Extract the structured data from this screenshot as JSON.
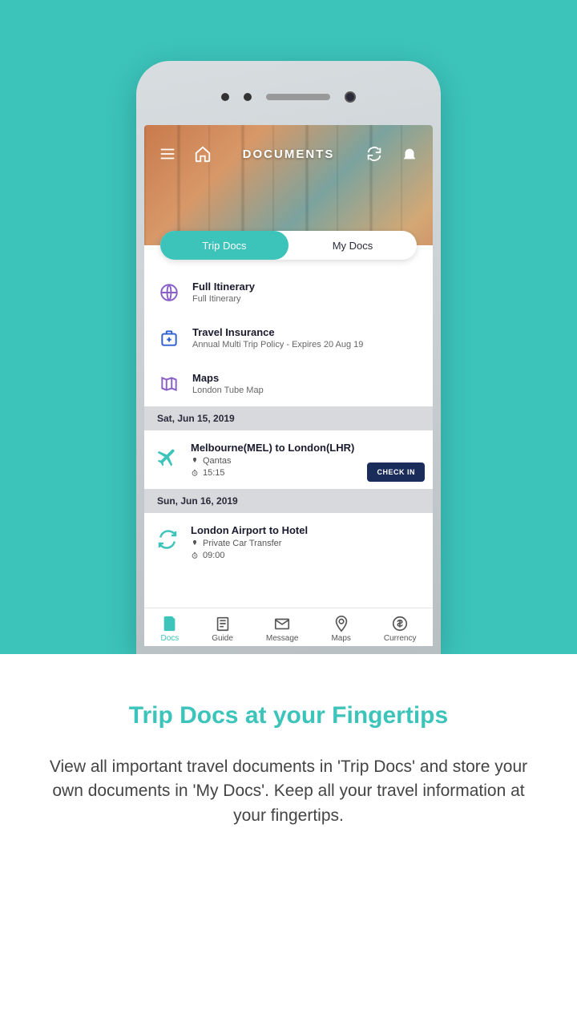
{
  "header": {
    "title": "DOCUMENTS"
  },
  "tabs": {
    "trip": "Trip Docs",
    "my": "My Docs"
  },
  "docs": [
    {
      "icon": "globe-icon",
      "title": "Full Itinerary",
      "sub": "Full Itinerary"
    },
    {
      "icon": "medkit-icon",
      "title": "Travel Insurance",
      "sub": "Annual Multi Trip Policy - Expires 20 Aug 19"
    },
    {
      "icon": "map-icon",
      "title": "Maps",
      "sub": "London Tube Map"
    }
  ],
  "segments": [
    {
      "date": "Sat, Jun 15, 2019",
      "title": "Melbourne(MEL) to London(LHR)",
      "provider": "Qantas",
      "time": "15:15",
      "icon": "plane-icon",
      "checkin": "CHECK IN"
    },
    {
      "date": "Sun, Jun 16, 2019",
      "title": "London Airport to Hotel",
      "provider": "Private Car Transfer",
      "time": "09:00",
      "icon": "transfer-icon",
      "checkin": ""
    }
  ],
  "nav": {
    "docs": "Docs",
    "guide": "Guide",
    "message": "Message",
    "maps": "Maps",
    "currency": "Currency"
  },
  "promo": {
    "title": "Trip Docs at your Fingertips",
    "body": "View all important travel documents in 'Trip Docs' and store your own documents in 'My Docs'. Keep all your travel information at your fingertips."
  }
}
